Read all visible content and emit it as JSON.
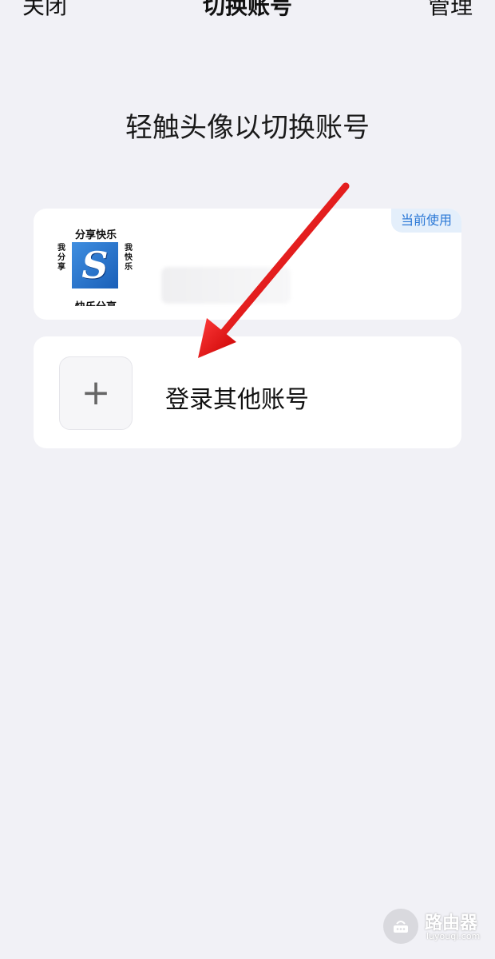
{
  "nav": {
    "close_label": "关闭",
    "title": "切换账号",
    "manage_label": "管理"
  },
  "hint_text": "轻触头像以切换账号",
  "current_account": {
    "badge": "当前使用",
    "avatar": {
      "top_text": "分享快乐",
      "left_text": "我分享",
      "right_text": "我快乐",
      "letter": "S",
      "bottom_text": "快乐分享"
    }
  },
  "add_account": {
    "icon": "plus-icon",
    "label": "登录其他账号"
  },
  "watermark": {
    "title": "路由器",
    "subtitle": "luyouqi.com"
  },
  "colors": {
    "background": "#f1f1f6",
    "card": "#ffffff",
    "badge_text": "#2b78d6",
    "badge_bg": "#e4effb",
    "arrow": "#e01010"
  }
}
